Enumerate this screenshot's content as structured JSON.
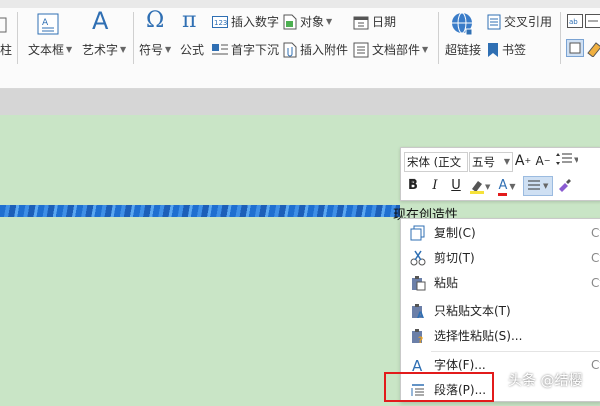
{
  "ribbon": {
    "row1": {
      "insert_number": "插入数字",
      "object": "对象",
      "date": "日期",
      "cross_reference": "交叉引用"
    },
    "row2": {
      "left_clip": "柱",
      "textbox": "文本框",
      "wordart": "艺术字",
      "symbol": "符号",
      "formula": "公式",
      "dropcap": "首字下沉",
      "attachment": "插入附件",
      "doc_parts": "文档部件",
      "hyperlink": "超链接",
      "bookmark": "书签"
    }
  },
  "document": {
    "text": "现在创造性"
  },
  "mini_toolbar": {
    "font": "宋体 (正文",
    "size": "五号",
    "bold": "B",
    "italic": "I",
    "underline": "U",
    "font_color_glyph": "A"
  },
  "context_menu": {
    "items": [
      {
        "label": "复制(C)",
        "shortcut": "Ct"
      },
      {
        "label": "剪切(T)",
        "shortcut": "Ct"
      },
      {
        "label": "粘贴",
        "shortcut": "Ct"
      },
      {
        "label": "只粘贴文本(T)",
        "shortcut": ""
      },
      {
        "label": "选择性粘贴(S)...",
        "shortcut": ""
      },
      {
        "label": "字体(F)...",
        "shortcut": "Ct"
      },
      {
        "label": "段落(P)...",
        "shortcut": ""
      }
    ]
  },
  "watermark": "头条 @结樱",
  "colors": {
    "accent_blue": "#2f6fb3",
    "page_bg": "#c9e5c6",
    "highlight_red": "#e21b1b"
  }
}
